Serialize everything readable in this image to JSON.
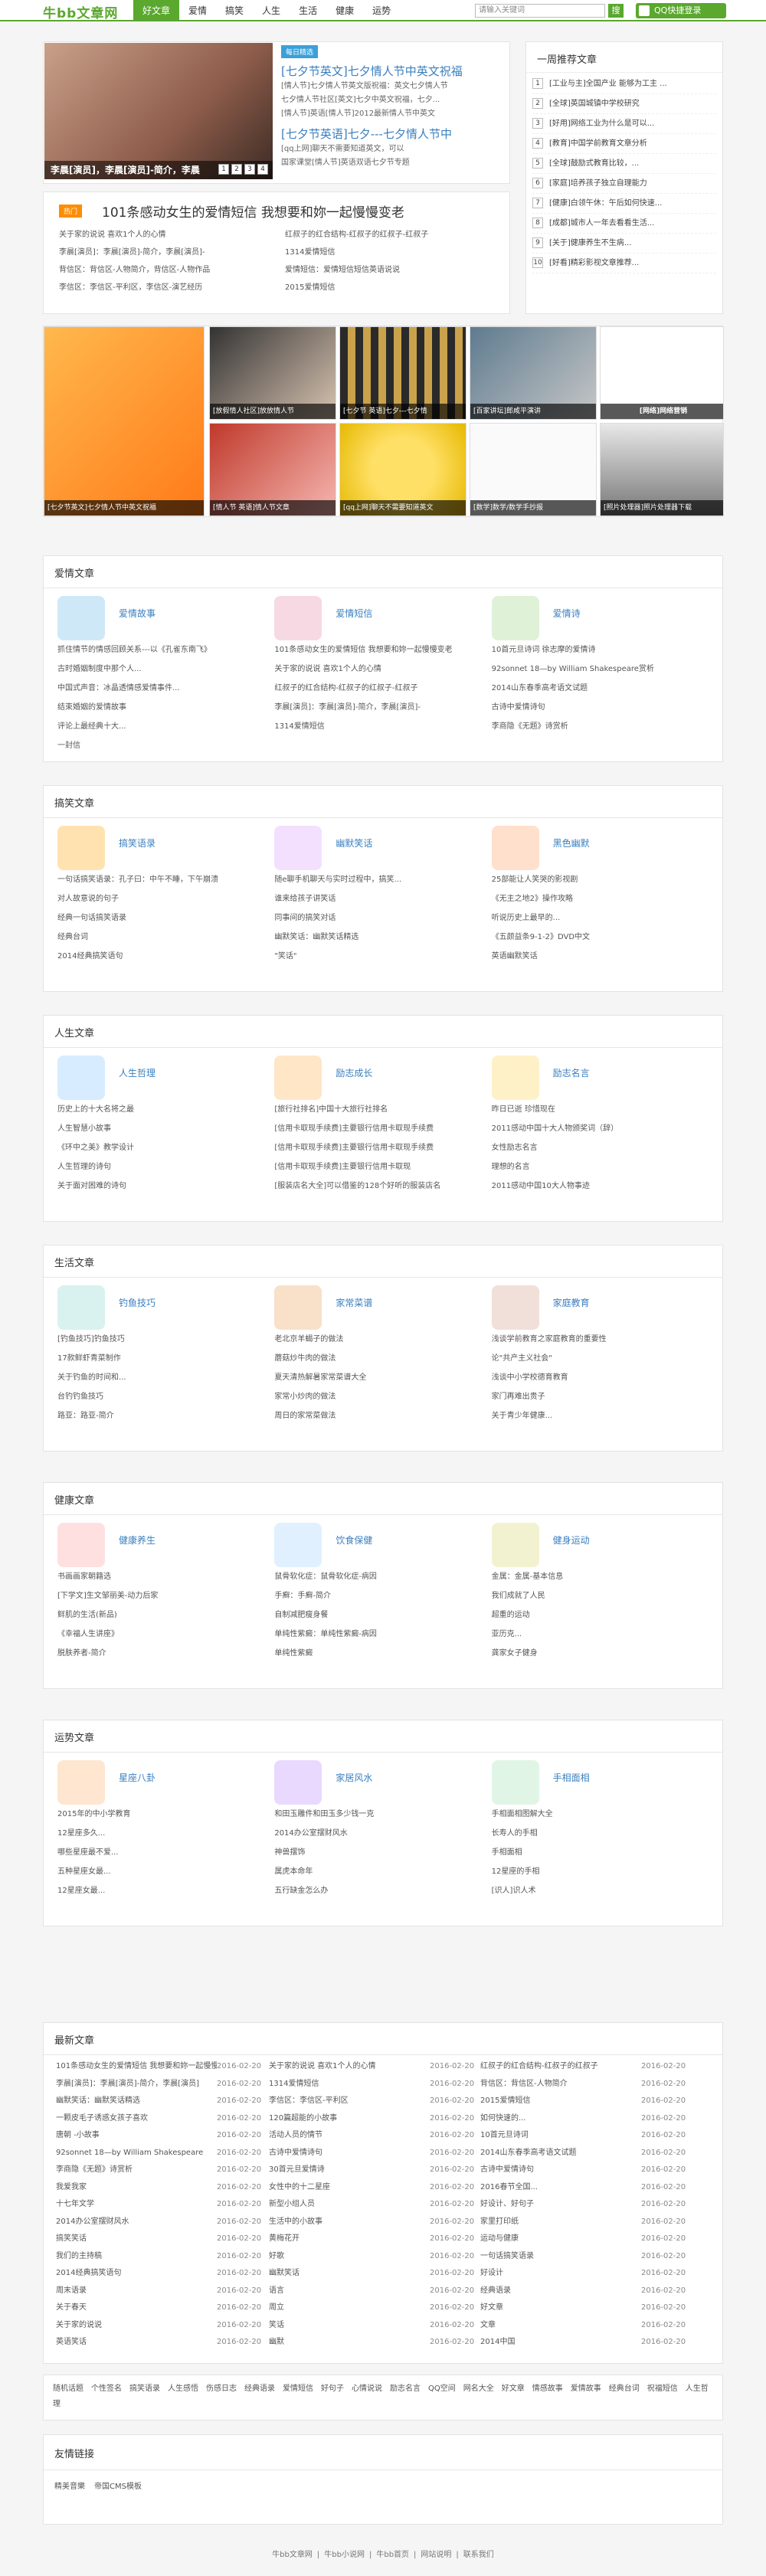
{
  "header": {
    "logo": "牛bb文章网",
    "nav": [
      "好文章",
      "爱情",
      "搞笑",
      "人生",
      "生活",
      "健康",
      "运势"
    ],
    "search_placeholder": "请输入关键词",
    "search_btn": "搜",
    "login": "QQ快捷登录"
  },
  "featured": {
    "caption": "李晨[演员]，李晨[演员]-简介，李晨",
    "dots": [
      "1",
      "2",
      "3",
      "4"
    ],
    "badge": "每日精选",
    "items": [
      {
        "title": "[七夕节英文]七夕情人节中英文祝福",
        "lines": [
          "[情人节]七夕情人节英文版祝福：英文七夕情人节",
          "七夕情人节社区[英文]七夕中英文祝福，七夕...",
          "[情人节]英语[情人节]2012最新情人节中英文"
        ]
      },
      {
        "title": "[七夕节英语]七夕---七夕情人节中",
        "lines": [
          "[qq上网]聊天不需要知道英文，可以",
          "国家课堂[情人节]英语双语七夕节专题"
        ]
      }
    ]
  },
  "stories": {
    "ribbon": "热门",
    "title": "101条感动女生的爱情短信 我想要和妳一起慢慢变老",
    "items": [
      "关于家的说说 喜欢1个人的心情",
      "红叔子的红合结构-红叔子的红叔子-红叔子",
      "李晨[演员]：李晨[演员]-简介，李晨[演员]-",
      "1314爱情短信",
      "背信区：背信区-人物简介，背信区-人物作品",
      "爱情短信：爱情短信短信英语说说",
      "李信区：李信区-平利区，李信区-演艺经历",
      "2015爱情短信"
    ]
  },
  "side": {
    "title": "一周推荐文章",
    "items": [
      "[工业与主]全国产业 能够为工主 ...",
      "[全球]英国城镇中学校研究",
      "[好用]网络工业为什么是可以...",
      "[教育]中国学前教育文章分析",
      "[全球]鼓励式教育比较，...",
      "[家庭]培养孩子独立自理能力",
      "[健康]白领午休：午后如何快速...",
      "[成都]城市人一年去看看生活...",
      "[关于]健康养生不生病...",
      "[好看]精彩影视文章推荐..."
    ]
  },
  "gallery": [
    {
      "cap": "[七夕节英文]七夕情人节中英文祝福"
    },
    {
      "cap": "[放假情人社区]放放情人节"
    },
    {
      "cap": "[七夕节 英语]七夕---七夕情"
    },
    {
      "cap": "[百家讲坛]郎咸平演讲"
    },
    {
      "cap": "[网络]网络营销"
    },
    {
      "cap": "[情人节 英语]情人节文章"
    },
    {
      "cap": "[qq上网]聊天不需要知道英文"
    },
    {
      "cap": "[数学]数学/数学手抄报"
    },
    {
      "cap": "[照片处理器]照片处理器下载"
    }
  ],
  "sections": [
    {
      "title": "爱情文章",
      "cols": [
        {
          "name": "爱情故事",
          "items": [
            "抓住情节的情感回顾关系---以《孔雀东南飞》",
            "古时婚姻制度中那个人...",
            "中国式声音：冰晶透情感爱情事件...",
            "结束婚姻的爱情故事",
            "评论上最经典十大...",
            "一封信"
          ]
        },
        {
          "name": "爱情短信",
          "items": [
            "101条感动女生的爱情短信 我想要和妳一起慢慢变老",
            "关于家的说说 喜欢1个人的心情",
            "红叔子的红合结构-红叔子的红叔子-红叔子",
            "李晨[演员]：李晨[演员]-简介，李晨[演员]-",
            "1314爱情短信"
          ]
        },
        {
          "name": "爱情诗",
          "items": [
            "10首元旦诗词 徐志摩的爱情诗",
            "92sonnet 18—by William Shakespeare赏析",
            "2014山东春季高考语文试题",
            "古诗中爱情诗句",
            "李商隐《无题》诗赏析"
          ]
        }
      ]
    },
    {
      "title": "搞笑文章",
      "cols": [
        {
          "name": "搞笑语录",
          "items": [
            "一句话搞笑语录：孔子曰：中午不睡，下午崩溃",
            "对人故意说的句子",
            "经典一句话搞笑语录",
            "经典台词",
            "2014经典搞笑语句"
          ]
        },
        {
          "name": "幽默笑话",
          "items": [
            "随e聊手机聊天与实时过程中，搞笑...",
            "谁来给孩子讲笑话",
            "同事间的搞笑对话",
            "幽默笑话：幽默笑话精选",
            "\"笑话\""
          ]
        },
        {
          "name": "黑色幽默",
          "items": [
            "25部能让人笑哭的影视剧",
            "《无主之地2》操作攻略",
            "听说历史上最早的...",
            "《五颜益条9-1-2》DVD中文",
            "英语幽默笑话"
          ]
        }
      ]
    },
    {
      "title": "人生文章",
      "cols": [
        {
          "name": "人生哲理",
          "items": [
            "历史上的十大名将之最",
            "人生智慧小故事",
            "《环中之美》教学设计",
            "人生哲理的诗句",
            "关于面对困难的诗句"
          ]
        },
        {
          "name": "励志成长",
          "items": [
            "[旅行社排名]中国十大旅行社排名",
            "[信用卡取现手续费]主要银行信用卡取现手续费",
            "[信用卡取现手续费]主要银行信用卡取现手续费",
            "[信用卡取现手续费]主要银行信用卡取现",
            "[服装店名大全]可以借鉴的128个好听的服装店名"
          ]
        },
        {
          "name": "励志名言",
          "items": [
            "昨日已逝 珍惜现在",
            "2011感动中国十大人物颁奖词（辞）",
            "女性励志名言",
            "理想的名言",
            "2011感动中国10大人物事迹"
          ]
        }
      ]
    },
    {
      "title": "生活文章",
      "cols": [
        {
          "name": "钓鱼技巧",
          "items": [
            "[钓鱼技巧]钓鱼技巧",
            "17款鲜虾青菜制作",
            "关于钓鱼的时间和...",
            "台钓钓鱼技巧",
            "路亚：路亚-简介"
          ]
        },
        {
          "name": "家常菜谱",
          "items": [
            "老北京羊蝎子的做法",
            "蘑菇炒牛肉的做法",
            "夏天清热解暑家常菜谱大全",
            "家常小炒肉的做法",
            "周日的家常菜做法"
          ]
        },
        {
          "name": "家庭教育",
          "items": [
            "浅谈学前教育之家庭教育的重要性",
            "论\"共产主义社会\"",
            "浅谈中小学校德育教育",
            "家门再难出贵子",
            "关于青少年健康..."
          ]
        }
      ]
    },
    {
      "title": "健康文章",
      "cols": [
        {
          "name": "健康养生",
          "items": [
            "书画画家朝籍选",
            "[下学文]生文邹丽美-动力后家",
            "鲜肌的生活(新品)",
            "《幸福人生讲座》",
            "脱肤养者-简介"
          ]
        },
        {
          "name": "饮食保健",
          "items": [
            "鼠骨软化症：鼠骨软化症-病因",
            "手癣：手癣-简介",
            "自制减肥瘦身餐",
            "单纯性紫癜：单纯性紫癜-病因",
            "单纯性紫癜"
          ]
        },
        {
          "name": "健身运动",
          "items": [
            "金属：金属-基本信息",
            "我们成就了人民",
            "超重的运动",
            "亚历克...",
            "龚家女子健身"
          ]
        }
      ]
    },
    {
      "title": "运势文章",
      "cols": [
        {
          "name": "星座八卦",
          "items": [
            "2015年的中小学教育",
            "12星座多久...",
            "哪些星座最不爱...",
            "五种星座女最...",
            "12星座女最..."
          ]
        },
        {
          "name": "家居风水",
          "items": [
            "和田玉雕件和田玉多少钱一克",
            "2014办公室摆财风水",
            "神兽摆饰",
            "属虎本命年",
            "五行缺金怎么办"
          ]
        },
        {
          "name": "手相面相",
          "items": [
            "手相面相图解大全",
            "长寿人的手相",
            "手相面相",
            "12星座的手相",
            "[识人]识人术"
          ]
        }
      ]
    }
  ],
  "latest": {
    "title": "最新文章",
    "rows": [
      [
        "101条感动女生的爱情短信 我想要和妳一起慢慢变老",
        "2016-02-20",
        "关于家的说说 喜欢1个人的心情",
        "2016-02-20",
        "红叔子的红合结构-红叔子的红叔子",
        "2016-02-20"
      ],
      [
        "李晨[演员]：李晨[演员]-简介，李晨[演员]",
        "2016-02-20",
        "1314爱情短信",
        "2016-02-20",
        "背信区：背信区-人物简介",
        "2016-02-20"
      ],
      [
        "幽默笑话：幽默笑话精选",
        "2016-02-20",
        "李信区：李信区-平利区",
        "2016-02-20",
        "2015爱情短信",
        "2016-02-20"
      ],
      [
        "一颗皮毛子诱惑女孩子喜欢",
        "2016-02-20",
        "120篇超能的小故事",
        "2016-02-20",
        "如何快速的...",
        "2016-02-20"
      ],
      [
        "唐朝 -小故事",
        "2016-02-20",
        "活动人员的情节",
        "2016-02-20",
        "10首元旦诗词",
        "2016-02-20"
      ],
      [
        "92sonnet 18—by William Shakespeare",
        "2016-02-20",
        "古诗中爱情诗句",
        "2016-02-20",
        "2014山东春季高考语文试题",
        "2016-02-20"
      ],
      [
        "李商隐《无题》诗赏析",
        "2016-02-20",
        "30首元旦爱情诗",
        "2016-02-20",
        "古诗中爱情诗句",
        "2016-02-20"
      ],
      [
        "我爱我家",
        "2016-02-20",
        "女性中的十二星座",
        "2016-02-20",
        "2016春节全国...",
        "2016-02-20"
      ],
      [
        "十七年文学",
        "2016-02-20",
        "新型小组人员",
        "2016-02-20",
        "好设计、好句子",
        "2016-02-20"
      ],
      [
        "2014办公室摆财风水",
        "2016-02-20",
        "生活中的小故事",
        "2016-02-20",
        "家里打印纸",
        "2016-02-20"
      ],
      [
        "搞笑笑话",
        "2016-02-20",
        "黄梅花开",
        "2016-02-20",
        "运动与健康",
        "2016-02-20"
      ],
      [
        "我们的主持稿",
        "2016-02-20",
        "好歌",
        "2016-02-20",
        "一句话搞笑语录",
        "2016-02-20"
      ],
      [
        "2014经典搞笑语句",
        "2016-02-20",
        "幽默笑话",
        "2016-02-20",
        "好设计",
        "2016-02-20"
      ],
      [
        "周末语录",
        "2016-02-20",
        "语言",
        "2016-02-20",
        "经典语录",
        "2016-02-20"
      ],
      [
        "关于春天",
        "2016-02-20",
        "周立",
        "2016-02-20",
        "好文章",
        "2016-02-20"
      ],
      [
        "关于家的说说",
        "2016-02-20",
        "笑话",
        "2016-02-20",
        "文章",
        "2016-02-20"
      ],
      [
        "英语笑话",
        "2016-02-20",
        "幽默",
        "2016-02-20",
        "2014中国",
        "2016-02-20"
      ]
    ]
  },
  "tags": [
    "随机话题",
    "个性签名",
    "搞笑语录",
    "人生感悟",
    "伤感日志",
    "经典语录",
    "爱情短信",
    "好句子",
    "心情说说",
    "励志名言",
    "QQ空间",
    "网名大全",
    "好文章",
    "情感故事",
    "爱情故事",
    "经典台词",
    "祝福短信",
    "人生哲理"
  ],
  "links": {
    "title": "友情链接",
    "items": [
      "精美音樂",
      "帝国CMS模板"
    ]
  },
  "footer": {
    "items": [
      "牛bb文章网",
      "牛bb小说网",
      "牛bb首页",
      "网站说明",
      "联系我们"
    ]
  }
}
